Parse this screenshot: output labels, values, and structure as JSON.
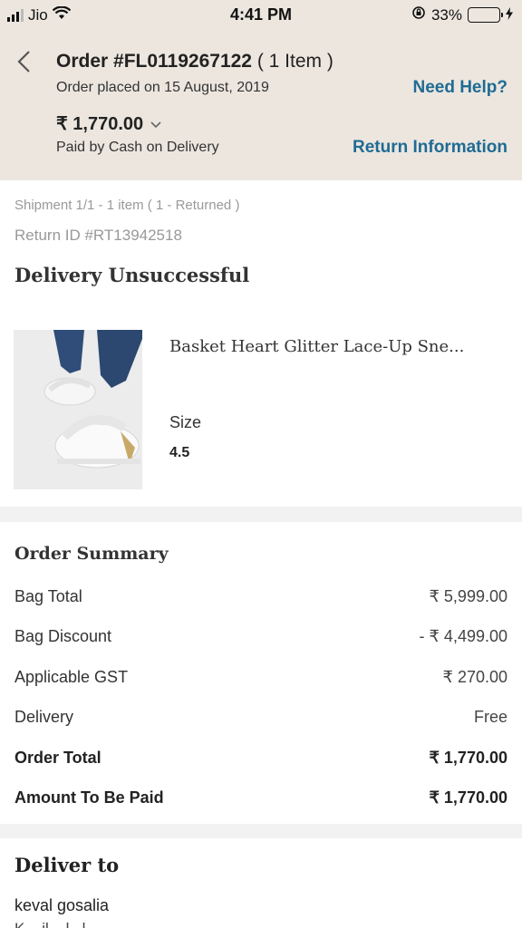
{
  "status_bar": {
    "carrier": "Jio",
    "time": "4:41 PM",
    "battery": "33%",
    "battery_level": 0.33
  },
  "header": {
    "order_label": "Order #FL0119267122",
    "item_count": "( 1 Item )",
    "order_date": "Order placed on 15 August, 2019",
    "need_help": "Need Help?",
    "amount": "₹ 1,770.00",
    "payment": "Paid by Cash on Delivery",
    "return_info": "Return Information"
  },
  "shipment": {
    "info": "Shipment 1/1 - 1 item ( 1 - Returned )",
    "return_id": "Return ID #RT13942518",
    "status": "Delivery Unsuccessful",
    "product_name": "Basket Heart Glitter Lace-Up Sne...",
    "size_label": "Size",
    "size_value": "4.5"
  },
  "summary": {
    "title": "Order Summary",
    "rows": [
      {
        "label": "Bag Total",
        "value": "₹ 5,999.00"
      },
      {
        "label": "Bag Discount",
        "value": "- ₹ 4,499.00"
      },
      {
        "label": "Applicable GST",
        "value": "₹ 270.00"
      },
      {
        "label": "Delivery",
        "value": "Free"
      },
      {
        "label": "Order Total",
        "value": "₹ 1,770.00"
      },
      {
        "label": "Amount To Be Paid",
        "value": "₹ 1,770.00"
      }
    ]
  },
  "deliver_to": {
    "title": "Deliver to",
    "name": "keval gosalia",
    "address": "K... il... l...l..."
  },
  "colors": {
    "header_bg": "#ece6df",
    "link": "#1f6b94",
    "battery_green": "#4cd964"
  }
}
